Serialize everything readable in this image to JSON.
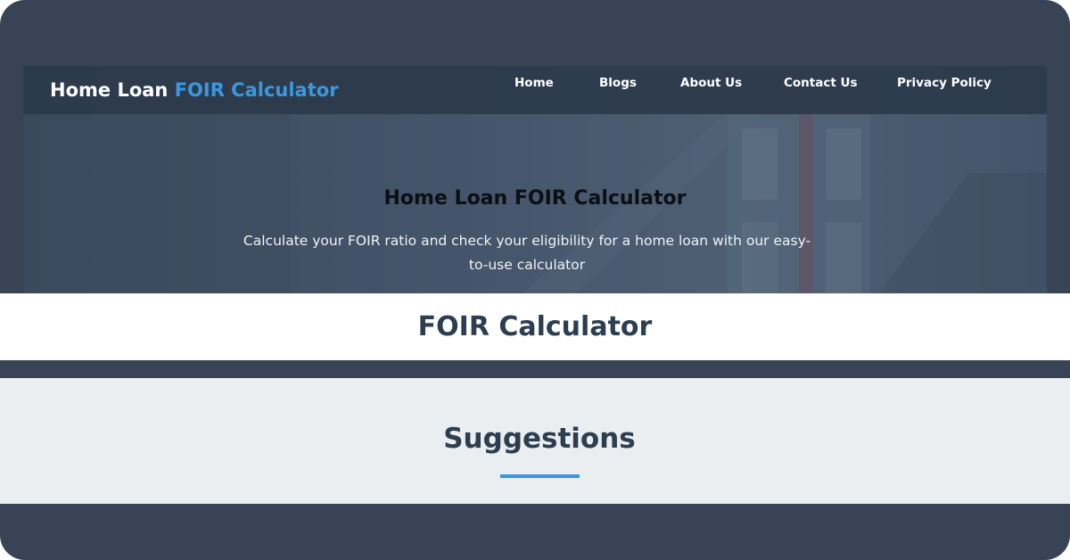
{
  "brand": {
    "part1": "Home Loan",
    "part2": "FOIR Calculator"
  },
  "nav": {
    "home": "Home",
    "blogs": "Blogs",
    "about": "About Us",
    "contact": "Contact Us",
    "privacy": "Privacy Policy"
  },
  "hero": {
    "title": "Home Loan FOIR Calculator",
    "subtitle": "Calculate your FOIR ratio and check your eligibility for a home loan with our easy-to-use calculator"
  },
  "calculator": {
    "title": "FOIR Calculator"
  },
  "suggestions": {
    "title": "Suggestions"
  },
  "colors": {
    "frame": "#384456",
    "navbar": "#2b394b",
    "accent": "#3498db",
    "heading": "#2c3e50",
    "suggestions_bg": "#ebeef0"
  }
}
